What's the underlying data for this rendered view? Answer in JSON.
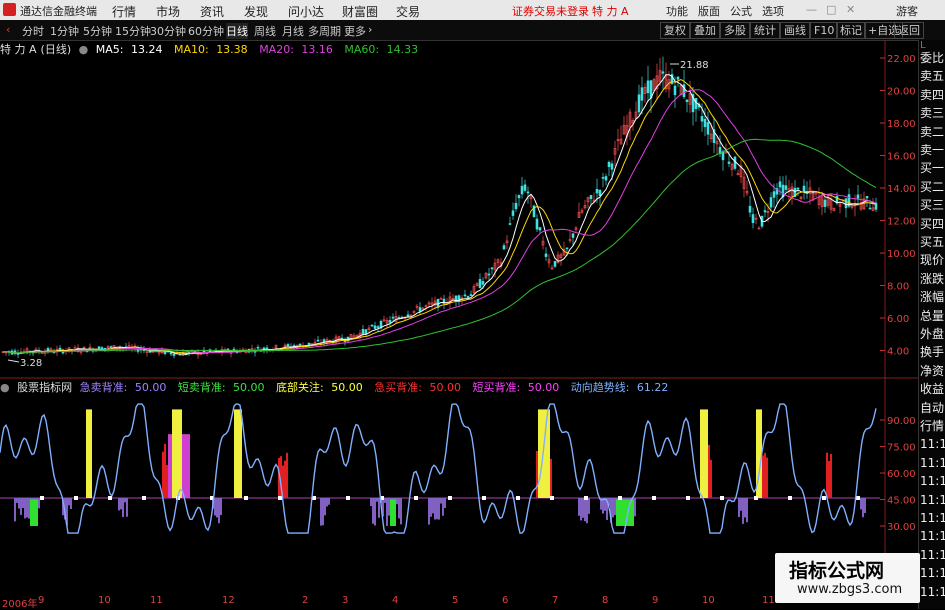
{
  "titlebar": {
    "app_name": "通达信金融终端",
    "menus": [
      "行情",
      "市场",
      "资讯",
      "发现",
      "问小达",
      "财富圈",
      "交易"
    ],
    "login_status": "证券交易未登录",
    "stock_title": "特 力 A",
    "right_menus": [
      "功能",
      "版面",
      "公式",
      "选项"
    ],
    "user": "游客"
  },
  "toolbar": {
    "periods": [
      "分时",
      "1分钟",
      "5分钟",
      "15分钟",
      "30分钟",
      "60分钟",
      "日线",
      "周线",
      "月线",
      "多周期",
      "更多"
    ],
    "active_period": "日线",
    "tools": [
      "复权",
      "叠加",
      "多股",
      "统计",
      "画线",
      "F10",
      "标记",
      "+自选",
      "返回"
    ]
  },
  "main_chart": {
    "stock": "特 力 A",
    "period_tag": "(日线)",
    "ma": [
      {
        "label": "MA5:",
        "value": "13.24",
        "color": "#ffffff"
      },
      {
        "label": "MA10:",
        "value": "13.38",
        "color": "#ffd700"
      },
      {
        "label": "MA20:",
        "value": "13.16",
        "color": "#e040e0"
      },
      {
        "label": "MA60:",
        "value": "14.33",
        "color": "#30c030"
      }
    ],
    "price_ticks": [
      "22.00",
      "20.00",
      "18.00",
      "16.00",
      "14.00",
      "12.00",
      "10.00",
      "8.00",
      "6.00",
      "4.00"
    ],
    "high_label": "21.88",
    "low_label": "3.28"
  },
  "indicator": {
    "name": "股票指标网",
    "lines": [
      {
        "label": "急卖背准:",
        "value": "50.00",
        "color": "#a080ff"
      },
      {
        "label": "短卖背准:",
        "value": "50.00",
        "color": "#40e040"
      },
      {
        "label": "底部关注:",
        "value": "50.00",
        "color": "#ffff40"
      },
      {
        "label": "急买背准:",
        "value": "50.00",
        "color": "#ff3030"
      },
      {
        "label": "短买背准:",
        "value": "50.00",
        "color": "#ff40ff"
      },
      {
        "label": "动向趋势线:",
        "value": "61.22",
        "color": "#80b0ff"
      }
    ],
    "ticks": [
      "90.00",
      "75.00",
      "60.00",
      "45.00",
      "30.00"
    ]
  },
  "date_axis": [
    "2006年",
    "9",
    "10",
    "11",
    "12",
    "2",
    "3",
    "4",
    "5",
    "6",
    "7",
    "8",
    "9",
    "10",
    "11"
  ],
  "right_panel": {
    "header": "L",
    "items": [
      "委比",
      "卖五",
      "卖四",
      "卖三",
      "卖二",
      "卖一",
      "买一",
      "买二",
      "买三",
      "买四",
      "买五",
      "现价",
      "涨跌",
      "涨幅",
      "总量",
      "外盘",
      "换手",
      "净资",
      "收益",
      "自动",
      "行情",
      "11:1",
      "11:1",
      "11:1",
      "11:1",
      "11:1",
      "11:1",
      "11:1",
      "11:1",
      "11:1"
    ]
  },
  "watermark": {
    "title": "指标公式网",
    "url": "www.zbgs3.com"
  }
}
